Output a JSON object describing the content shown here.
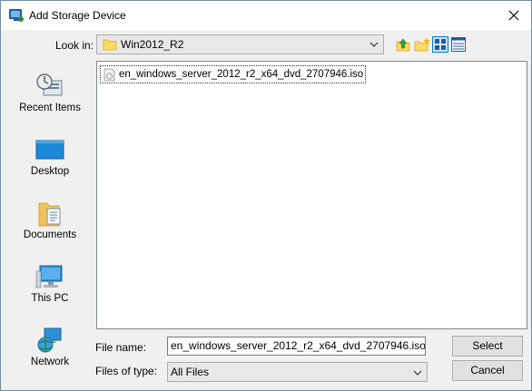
{
  "window": {
    "title": "Add Storage Device"
  },
  "lookin": {
    "label": "Look in:",
    "value": "Win2012_R2"
  },
  "toolbar": {
    "icons": [
      "up-folder-icon",
      "new-folder-icon",
      "list-view-icon",
      "details-view-icon"
    ]
  },
  "places": [
    {
      "label": "Recent Items",
      "icon": "recent-items-icon"
    },
    {
      "label": "Desktop",
      "icon": "desktop-icon"
    },
    {
      "label": "Documents",
      "icon": "documents-icon"
    },
    {
      "label": "This PC",
      "icon": "this-pc-icon"
    },
    {
      "label": "Network",
      "icon": "network-icon"
    }
  ],
  "files": [
    {
      "name": "en_windows_server_2012_r2_x64_dvd_2707946.iso",
      "icon": "iso-file-icon"
    }
  ],
  "filename": {
    "label": "File name:",
    "value": "en_windows_server_2012_r2_x64_dvd_2707946.iso"
  },
  "filetype": {
    "label": "Files of type:",
    "value": "All Files"
  },
  "buttons": {
    "select": "Select",
    "cancel": "Cancel"
  },
  "colors": {
    "accent": "#0078d7",
    "folder": "#ffd866",
    "selection_border": "#333333"
  }
}
